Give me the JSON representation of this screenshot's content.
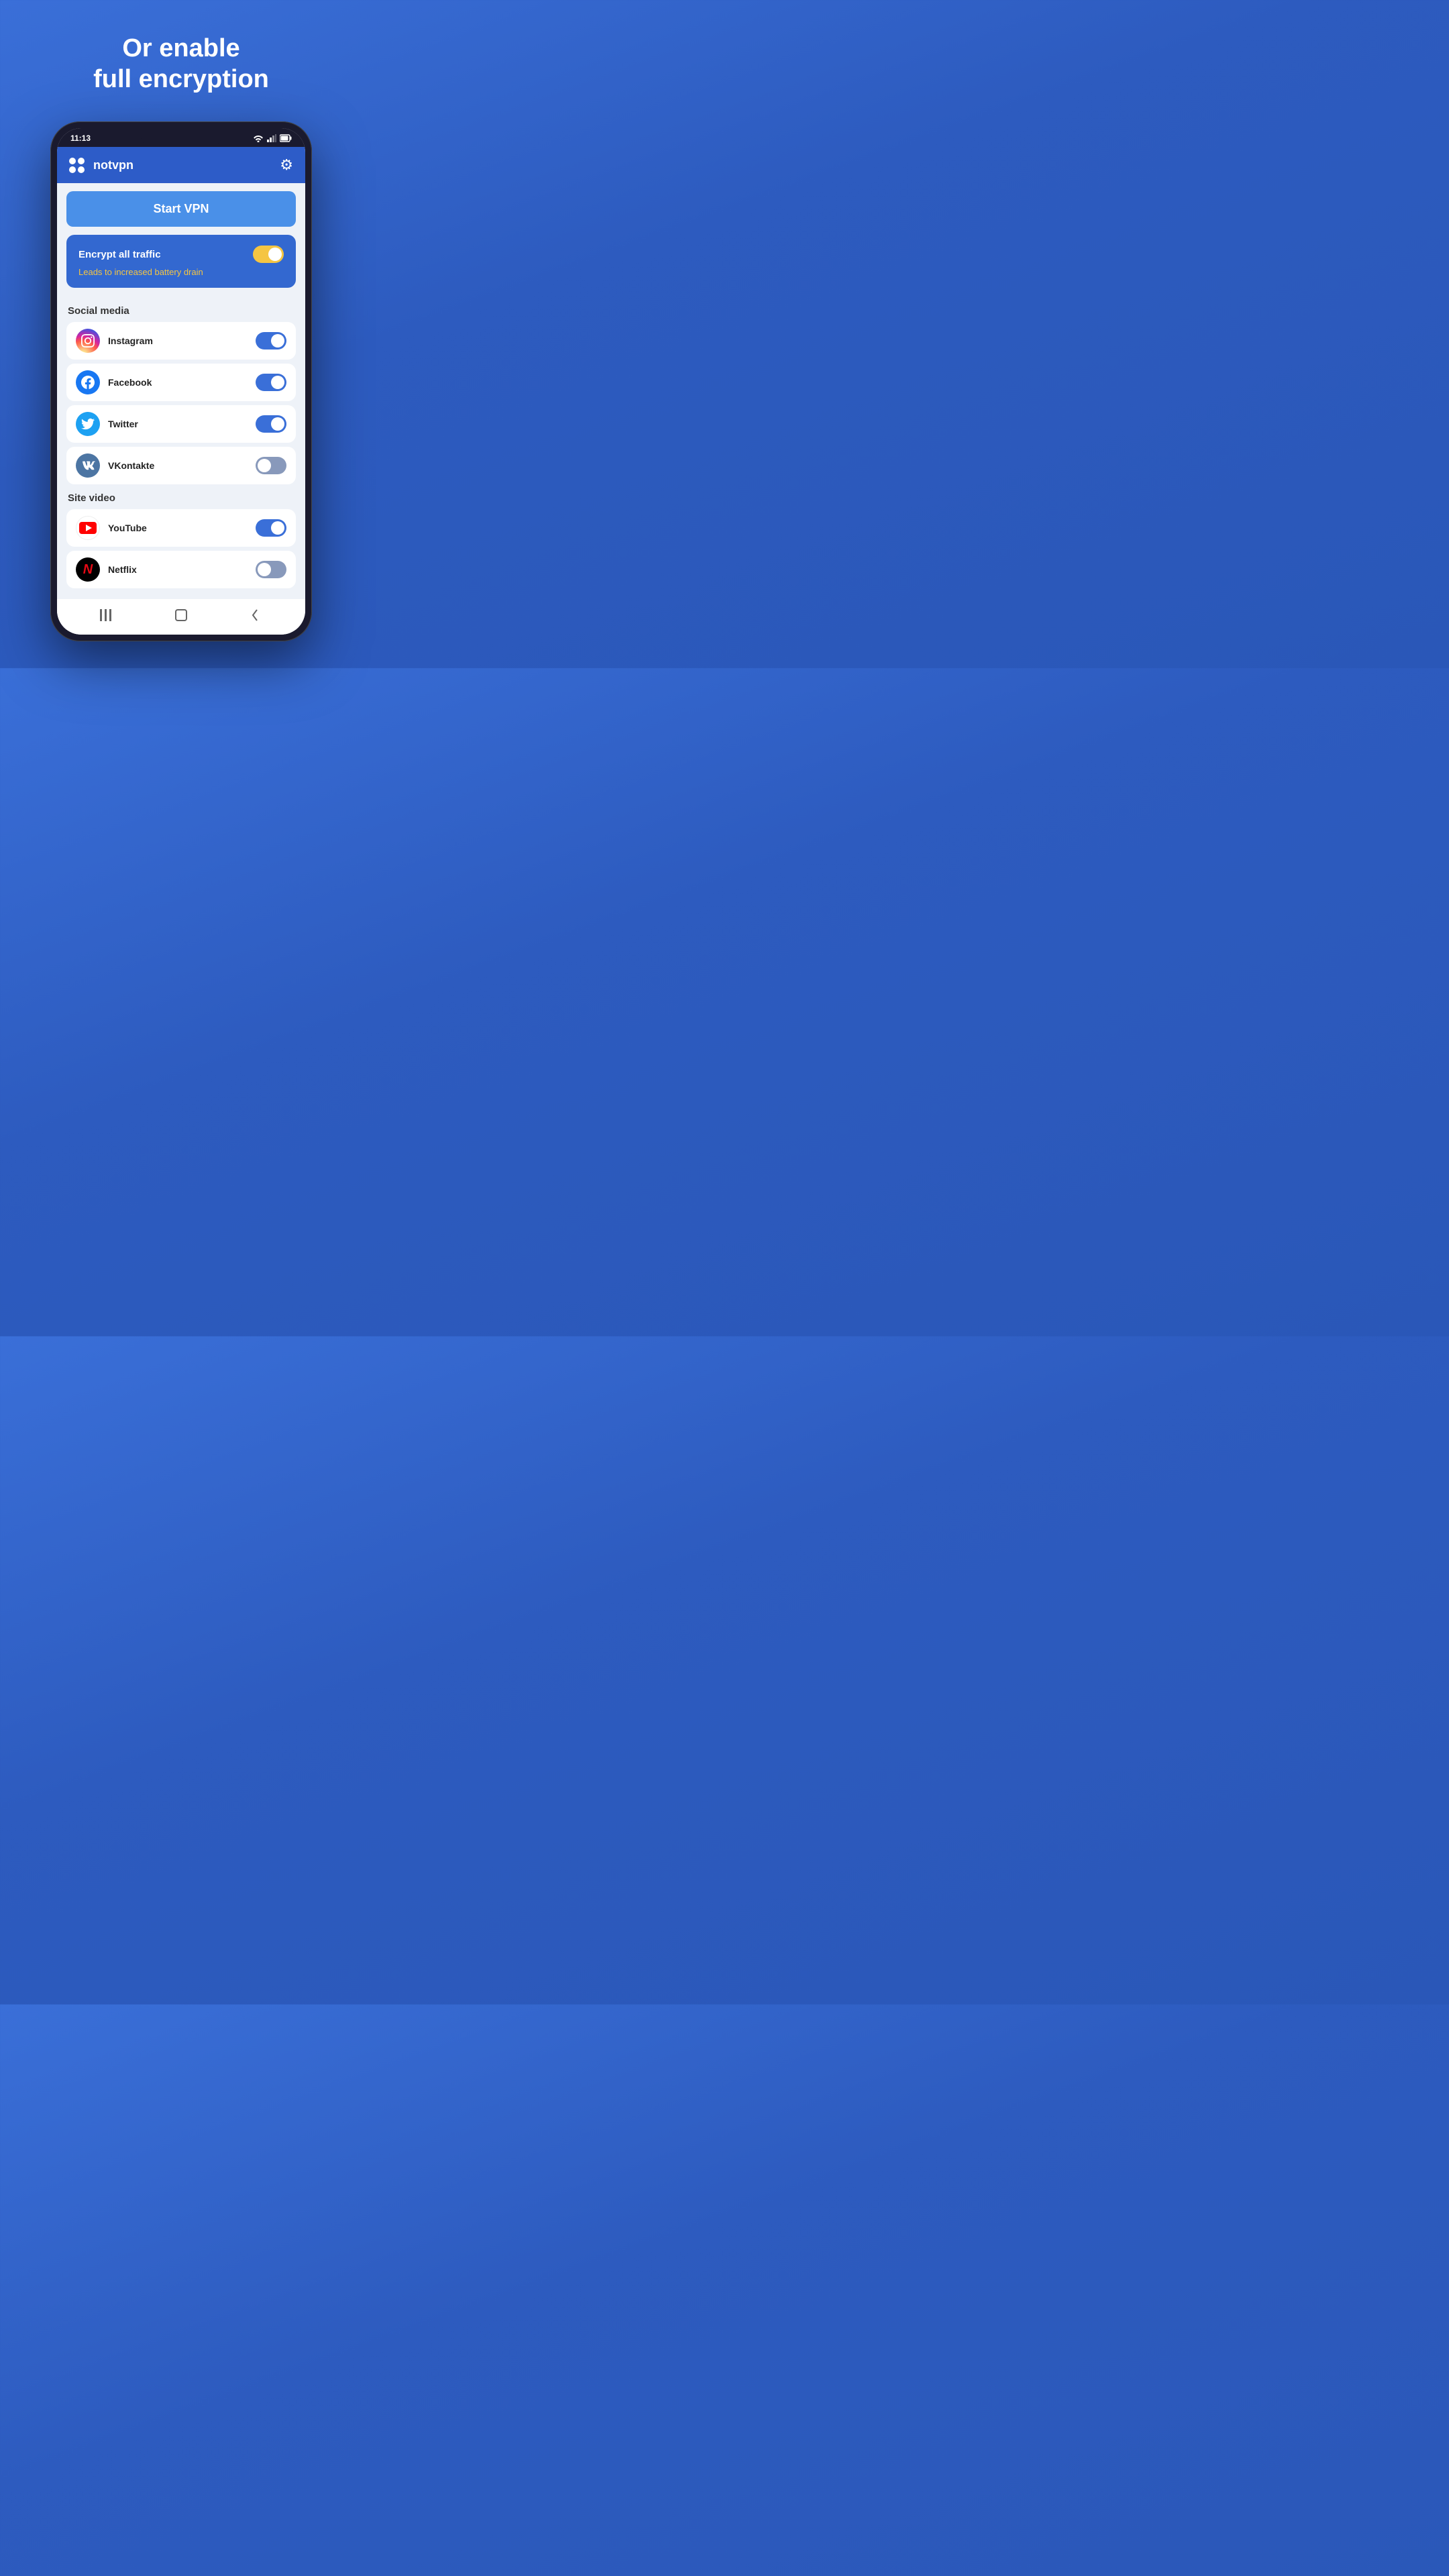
{
  "headline": {
    "line1": "Or enable",
    "line2": "full encryption"
  },
  "statusBar": {
    "time": "11:13",
    "icons": "WiFi Signal Battery"
  },
  "appHeader": {
    "appName": "notvpn",
    "gearIcon": "⚙"
  },
  "startButton": {
    "label": "Start VPN"
  },
  "encryptCard": {
    "label": "Encrypt all traffic",
    "warning": "Leads to increased battery drain",
    "toggleState": "on"
  },
  "socialMedia": {
    "sectionTitle": "Social media",
    "apps": [
      {
        "name": "Instagram",
        "icon": "instagram",
        "toggleState": "on-blue"
      },
      {
        "name": "Facebook",
        "icon": "facebook",
        "toggleState": "on-blue"
      },
      {
        "name": "Twitter",
        "icon": "twitter",
        "toggleState": "on-blue"
      },
      {
        "name": "VKontakte",
        "icon": "vk",
        "toggleState": "off"
      }
    ]
  },
  "siteVideo": {
    "sectionTitle": "Site video",
    "apps": [
      {
        "name": "YouTube",
        "icon": "youtube",
        "toggleState": "on-blue"
      },
      {
        "name": "Netflix",
        "icon": "netflix",
        "toggleState": "off"
      }
    ]
  },
  "bottomNav": {
    "menu": "|||",
    "home": "□",
    "back": "‹"
  }
}
